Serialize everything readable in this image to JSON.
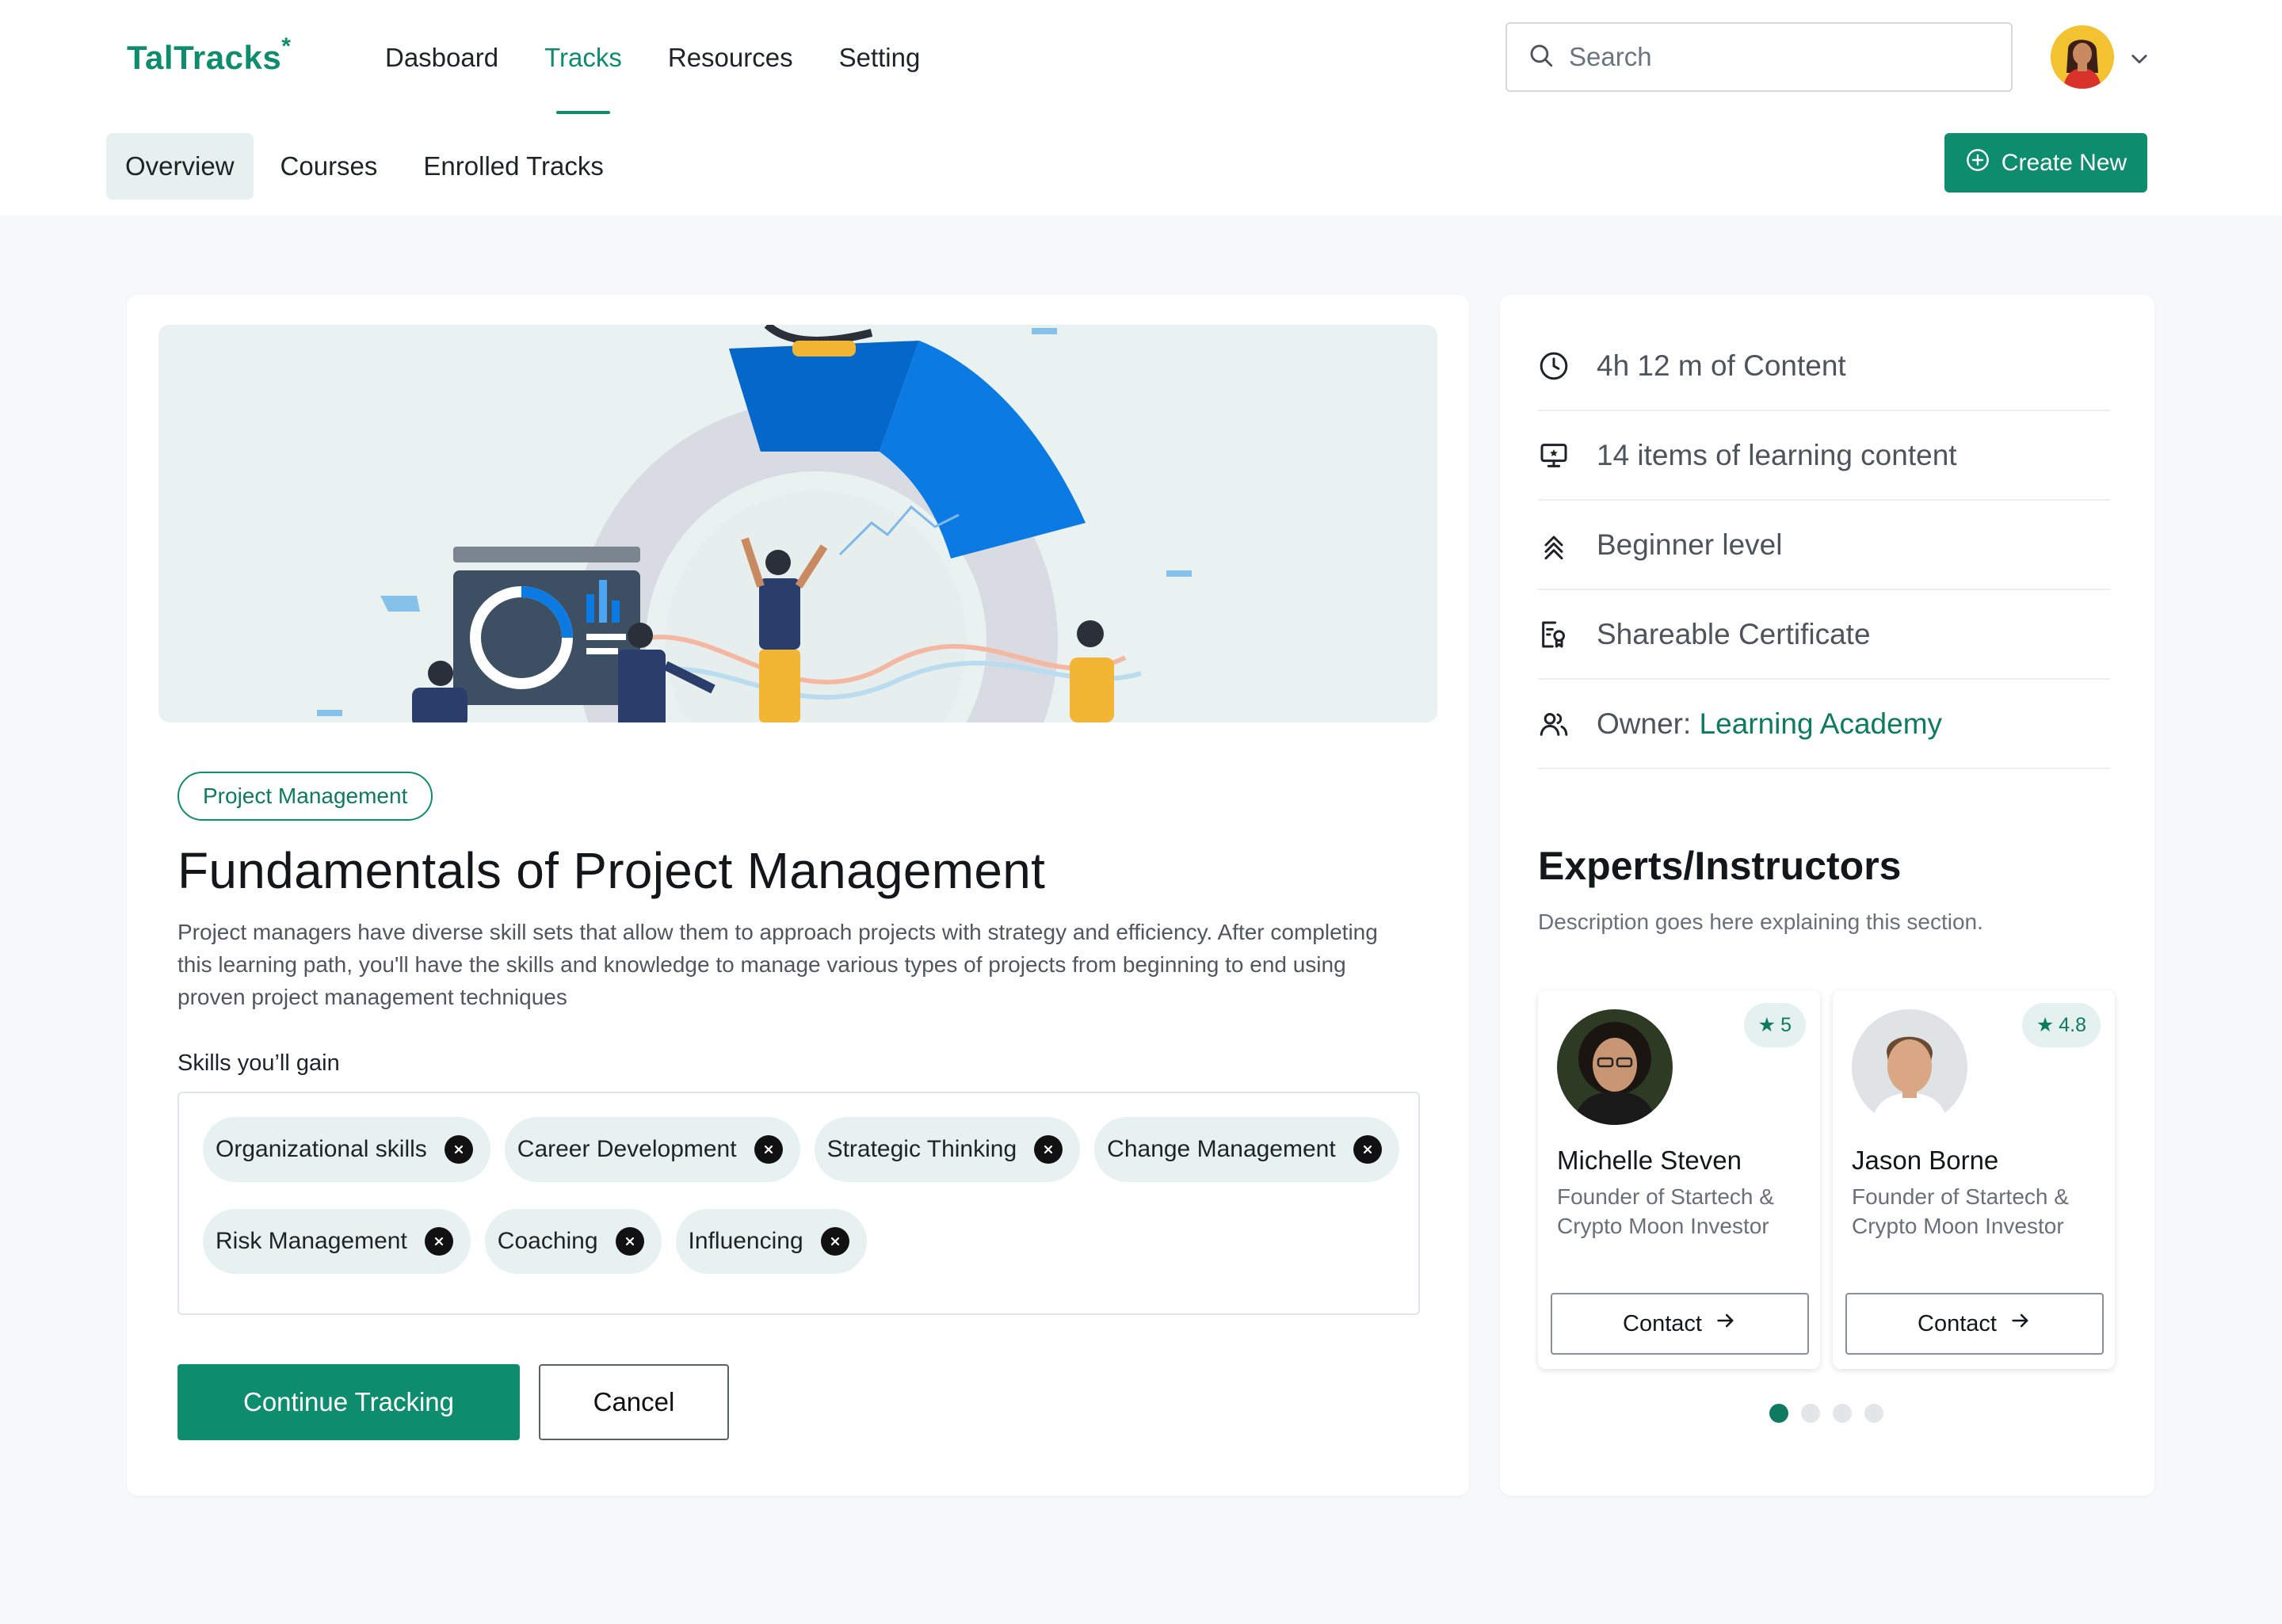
{
  "brand": {
    "logo": "TalTracks",
    "logo_mark": "*"
  },
  "nav": {
    "items": [
      {
        "label": "Dasboard",
        "active": false
      },
      {
        "label": "Tracks",
        "active": true
      },
      {
        "label": "Resources",
        "active": false
      },
      {
        "label": "Setting",
        "active": false
      }
    ]
  },
  "search": {
    "placeholder": "Search",
    "value": ""
  },
  "user": {
    "avatar_icon": "user-avatar"
  },
  "subnav": {
    "tabs": [
      {
        "label": "Overview",
        "active": true
      },
      {
        "label": "Courses",
        "active": false
      },
      {
        "label": "Enrolled Tracks",
        "active": false
      }
    ],
    "create_label": "Create New"
  },
  "course": {
    "tag": "Project Management",
    "title": "Fundamentals of Project Management",
    "description": "Project managers have diverse skill sets that allow them to approach projects with strategy and efficiency. After completing this learning path, you'll have the skills and knowledge to manage various types of projects from beginning to end using proven project management techniques",
    "skills_label": "Skills you’ll gain",
    "skills": [
      "Organizational skills",
      "Career Development",
      "Strategic Thinking",
      "Change Management",
      "Risk Management",
      "Coaching",
      "Influencing"
    ],
    "primary_action": "Continue Tracking",
    "secondary_action": "Cancel"
  },
  "meta": {
    "content_duration": "4h 12 m of Content",
    "items_count": "14 items of learning content",
    "level": "Beginner level",
    "certificate": "Shareable Certificate",
    "owner_label": "Owner:",
    "owner_name": "Learning Academy"
  },
  "experts": {
    "title": "Experts/Instructors",
    "description": "Description goes here explaining this section.",
    "contact_label": "Contact",
    "list": [
      {
        "name": "Michelle Steven",
        "role": "Founder of Startech & Crypto Moon Investor",
        "rating": "5"
      },
      {
        "name": "Jason Borne",
        "role": "Founder of Startech & Crypto Moon Investor",
        "rating": "4.8"
      }
    ],
    "pagination": {
      "pages": 4,
      "current": 1
    }
  },
  "colors": {
    "accent": "#0e8c6e",
    "accent_light": "#e7f2f0",
    "background": "#f7f8f9"
  }
}
